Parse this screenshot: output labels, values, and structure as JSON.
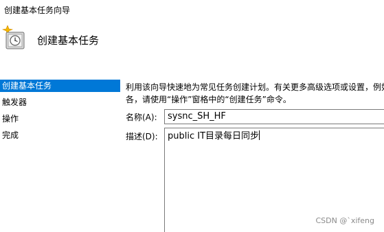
{
  "window": {
    "title": "创建基本任务向导"
  },
  "header": {
    "title": "创建基本任务",
    "icon": "task-clock-sparkle-icon"
  },
  "sidebar": {
    "items": [
      {
        "label": "创建基本任务",
        "selected": true
      },
      {
        "label": "触发器",
        "selected": false
      },
      {
        "label": "操作",
        "selected": false
      },
      {
        "label": "完成",
        "selected": false
      }
    ]
  },
  "main": {
    "description_line1": "利用该向导快速地为常见任务创建计划。有关更多高级选项或设置，例如多",
    "description_line2": "各，请使用“操作”窗格中的“创建任务”命令。",
    "name_label": "名称(A):",
    "name_value": "sysnc_SH_HF",
    "desc_label": "描述(D):",
    "desc_value": "public IT目录每日同步"
  },
  "watermark": "CSDN @`xifeng",
  "colors": {
    "selection": "#0078d7",
    "input_border": "#7a7a7a"
  }
}
